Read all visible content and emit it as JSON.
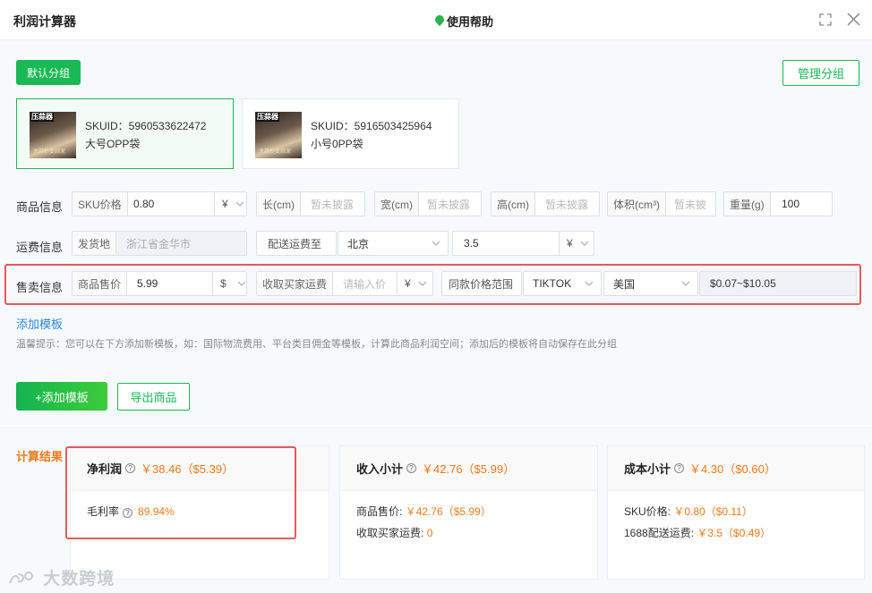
{
  "window": {
    "title": "利润计算器",
    "help": "使用帮助"
  },
  "groups": {
    "default_group": "默认分组",
    "manage_group": "管理分组"
  },
  "skus": [
    {
      "thumb_label": "压蒜器",
      "thumb_caption": "大蒜秒变蒜泥",
      "id_text": "SKUID：5960533622472",
      "name": "大号OPP袋"
    },
    {
      "thumb_label": "压蒜器",
      "thumb_caption": "大蒜秒变蒜泥",
      "id_text": "SKUID：5916503425964",
      "name": "小号0PP袋"
    }
  ],
  "product": {
    "label": "商品信息",
    "sku_price_label": "SKU价格",
    "sku_price": "0.80",
    "currency": "¥",
    "length_label": "长(cm)",
    "width_label": "宽(cm)",
    "height_label": "高(cm)",
    "volume_label": "体积(cm³)",
    "placeholder_na": "暂未披露",
    "volume_placeholder": "暂未披",
    "weight_label": "重量(g)",
    "weight": "100"
  },
  "shipping": {
    "label": "运费信息",
    "origin_label": "发货地",
    "origin": "浙江省金华市",
    "to_label": "配送运费至",
    "destination": "北京",
    "fee": "3.5",
    "currency": "¥"
  },
  "selling": {
    "label": "售卖信息",
    "price_label": "商品售价",
    "price": "5.99",
    "price_currency": "$",
    "buyer_fee_label": "收取买家运费",
    "buyer_fee_placeholder": "请输入价",
    "buyer_fee_currency": "¥",
    "range_label": "同款价格范围",
    "platform": "TIKTOK",
    "country": "美国",
    "range": "$0.07~$10.05"
  },
  "template": {
    "add_link": "添加模板",
    "tip": "温馨提示：您可以在下方添加新模板，如：国际物流费用、平台类目佣金等模板，计算此商品利润空间；添加后的模板将自动保存在此分组",
    "add_button": "+添加模板",
    "export_button": "导出商品"
  },
  "results": {
    "label": "计算结果",
    "profit": {
      "title": "净利润",
      "value": "￥38.46（$5.39）",
      "margin_label": "毛利率",
      "margin": "89.94%"
    },
    "income": {
      "title": "收入小计",
      "value": "￥42.76（$5.99）",
      "line1_label": "商品售价:",
      "line1_value": "￥42.76（$5.99）",
      "line2_label": "收取买家运费:",
      "line2_value": "0"
    },
    "cost": {
      "title": "成本小计",
      "value": "￥4.30（$0.60）",
      "line1_label": "SKU价格:",
      "line1_value": "￥0.80（$0.11）",
      "line2_label": "1688配送运费:",
      "line2_value": "￥3.5（$0.49）"
    }
  },
  "watermark": "大数跨境"
}
